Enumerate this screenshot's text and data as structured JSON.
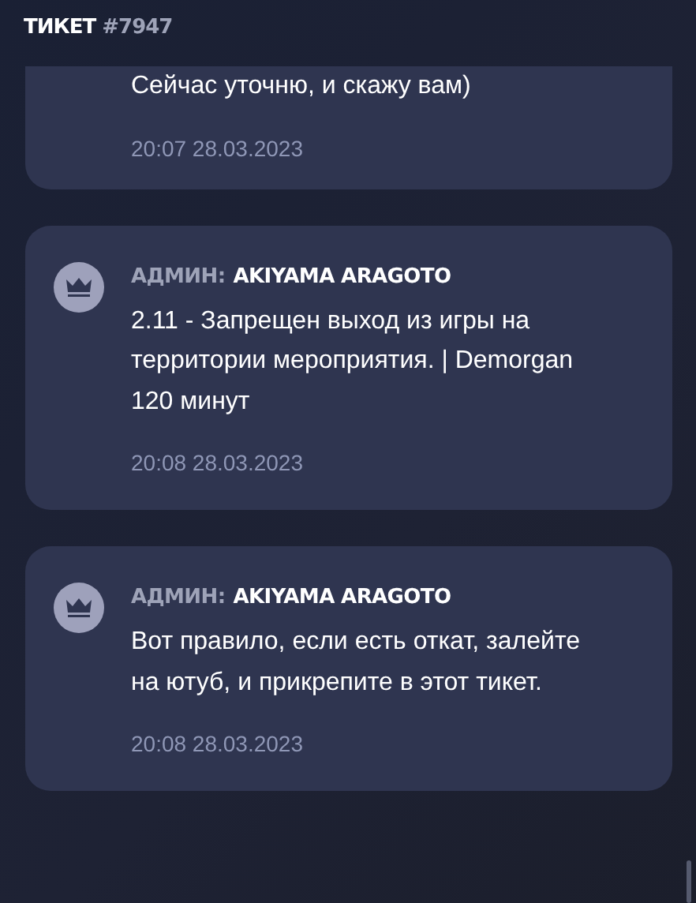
{
  "header": {
    "title": "ТИКЕТ",
    "number": "#7947"
  },
  "messages": [
    {
      "text": "Сейчас уточню, и скажу вам)",
      "time": "20:07 28.03.2023"
    },
    {
      "role": "АДМИН:",
      "author": "AKIYAMA ARAGOTO",
      "text": "2.11 - Запрещен выход из игры на территории мероприятия. | Demorgan 120 минут",
      "time": "20:08 28.03.2023"
    },
    {
      "role": "АДМИН:",
      "author": "AKIYAMA ARAGOTO",
      "text": "Вот правило, если есть откат, залейте на ютуб, и прикрепите в этот тикет.",
      "time": "20:08 28.03.2023"
    }
  ]
}
